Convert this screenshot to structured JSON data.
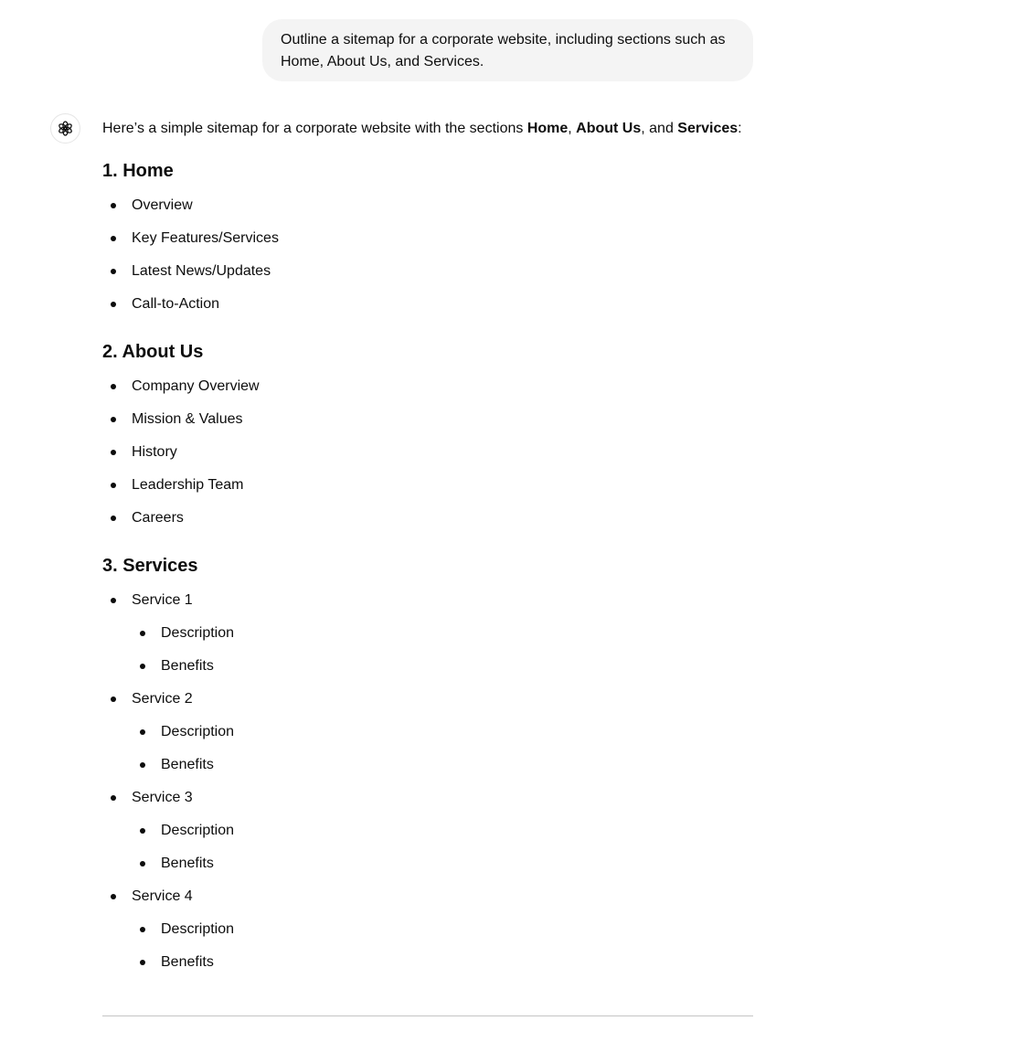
{
  "user_message": "Outline a  sitemap for a corporate website, including sections such as Home, About Us, and Services.",
  "assistant": {
    "avatar_icon": "openai-logo-icon",
    "intro": {
      "prefix": "Here’s a simple sitemap for a corporate website with the sections ",
      "b1": "Home",
      "sep1": ", ",
      "b2": "About Us",
      "sep2": ", and ",
      "b3": "Services",
      "suffix": ":"
    },
    "sections": [
      {
        "title": "1. Home",
        "items": [
          "Overview",
          "Key Features/Services",
          "Latest News/Updates",
          "Call-to-Action"
        ]
      },
      {
        "title": "2. About Us",
        "items": [
          "Company Overview",
          "Mission & Values",
          "History",
          "Leadership Team",
          "Careers"
        ]
      },
      {
        "title": "3. Services",
        "items": [
          {
            "label": "Service 1",
            "sub": [
              "Description",
              "Benefits"
            ]
          },
          {
            "label": "Service 2",
            "sub": [
              "Description",
              "Benefits"
            ]
          },
          {
            "label": "Service 3",
            "sub": [
              "Description",
              "Benefits"
            ]
          },
          {
            "label": "Service 4",
            "sub": [
              "Description",
              "Benefits"
            ]
          }
        ]
      }
    ]
  }
}
